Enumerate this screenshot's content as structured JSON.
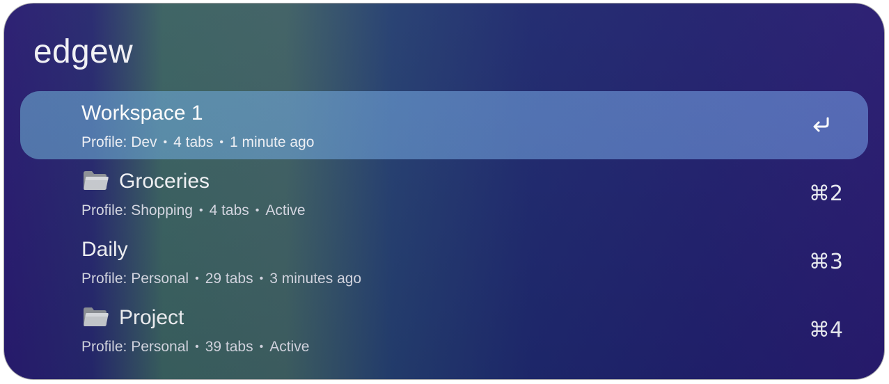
{
  "search": {
    "query": "edgew"
  },
  "results": [
    {
      "title": "Workspace 1",
      "has_folder_icon": false,
      "profile": "Profile: Dev",
      "tabs": "4 tabs",
      "status": "1 minute ago",
      "shortcut": "",
      "shortcut_icon": "return-icon",
      "selected": true
    },
    {
      "title": "Groceries",
      "has_folder_icon": true,
      "profile": "Profile: Shopping",
      "tabs": "4 tabs",
      "status": "Active",
      "shortcut": "⌘2",
      "selected": false
    },
    {
      "title": "Daily",
      "has_folder_icon": false,
      "profile": "Profile: Personal",
      "tabs": "29 tabs",
      "status": "3 minutes ago",
      "shortcut": "⌘3",
      "selected": false
    },
    {
      "title": "Project",
      "has_folder_icon": true,
      "profile": "Profile: Personal",
      "tabs": "39 tabs",
      "status": "Active",
      "shortcut": "⌘4",
      "selected": false
    }
  ],
  "separator": "•",
  "colors": {
    "selected_row": "#6a9fd6",
    "text": "#f4f5f8",
    "subtext": "#d9dbe6"
  }
}
